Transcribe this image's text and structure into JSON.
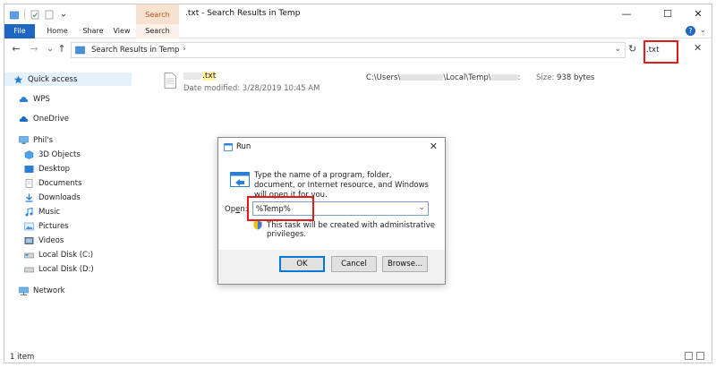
{
  "window": {
    "title": ".txt - Search Results in Temp",
    "context_tab": "Search Tools",
    "minimize_glyph": "—",
    "maximize_glyph": "☐",
    "close_glyph": "✕"
  },
  "ribbon": {
    "tabs": [
      "File",
      "Home",
      "Share",
      "View",
      "Search"
    ],
    "collapse_glyph": "⌄",
    "help_glyph": "?"
  },
  "navigation": {
    "back_glyph": "←",
    "forward_glyph": "→",
    "recent_glyph": "⌄",
    "up_glyph": "↑",
    "address_path": "Search Results in Temp",
    "address_chevron": "›",
    "address_dropdown": "⌄",
    "refresh_glyph": "↻",
    "search_value": ".txt",
    "search_clear_glyph": "✕"
  },
  "sidebar": {
    "items": [
      {
        "label": "Quick access",
        "icon": "star-icon"
      },
      {
        "label": "WPS",
        "icon": "cloud-icon"
      },
      {
        "label": "OneDrive",
        "icon": "cloud-icon"
      },
      {
        "label": "Phil's",
        "icon": "computer-icon"
      },
      {
        "label": "3D Objects",
        "icon": "cube-icon"
      },
      {
        "label": "Desktop",
        "icon": "desktop-icon"
      },
      {
        "label": "Documents",
        "icon": "document-icon"
      },
      {
        "label": "Downloads",
        "icon": "download-icon"
      },
      {
        "label": "Music",
        "icon": "music-icon"
      },
      {
        "label": "Pictures",
        "icon": "picture-icon"
      },
      {
        "label": "Videos",
        "icon": "video-icon"
      },
      {
        "label": "Local Disk (C:)",
        "icon": "drive-icon"
      },
      {
        "label": "Local Disk (D:)",
        "icon": "drive-icon"
      },
      {
        "label": "Network",
        "icon": "network-icon"
      }
    ]
  },
  "results": [
    {
      "name_ext": ".txt",
      "modified": "Date modified: 3/28/2019 10:45 AM",
      "path_start": "C:\\Users\\",
      "path_mid": "\\Local\\Temp\\",
      "path_end": ":",
      "size_label": "Size:",
      "size_value": "938 bytes"
    }
  ],
  "status": {
    "count": "1 item"
  },
  "run_dialog": {
    "title": "Run",
    "close_glyph": "✕",
    "description": "Type the name of a program, folder, document, or Internet resource, and Windows will open it for you.",
    "open_label_prefix": "Op",
    "open_label_underlined": "e",
    "open_label_suffix": "n:",
    "open_value": "%Temp%",
    "open_dropdown": "⌄",
    "admin_note": "This task will be created with administrative privileges.",
    "buttons": {
      "ok": "OK",
      "cancel": "Cancel",
      "browse": "Browse..."
    }
  },
  "colors": {
    "accent": "#1f66c2",
    "highlight_box": "#e11a1a",
    "context_tab": "#f8e1cf",
    "search_highlight": "#fff3a3"
  }
}
